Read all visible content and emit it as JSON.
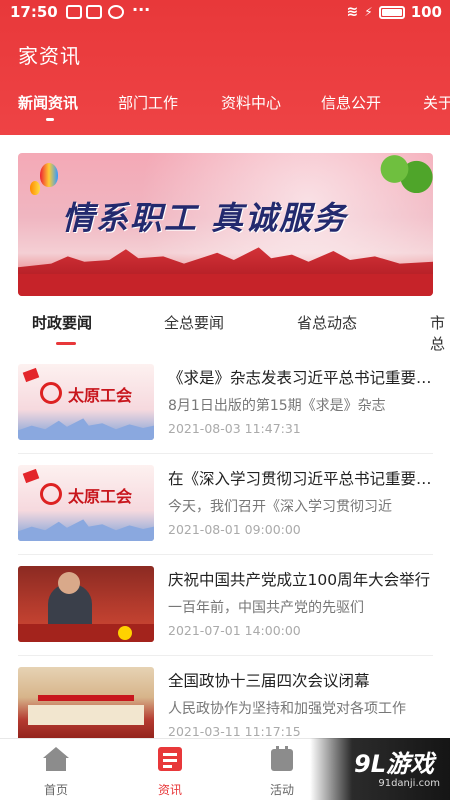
{
  "status_bar": {
    "time": "17:50",
    "battery": "100"
  },
  "header": {
    "title": "家资讯",
    "tabs": [
      {
        "label": "新闻资讯",
        "active": true
      },
      {
        "label": "部门工作"
      },
      {
        "label": "资料中心"
      },
      {
        "label": "信息公开"
      },
      {
        "label": "关于"
      }
    ]
  },
  "banner": {
    "slogan": "情系职工 真诚服务"
  },
  "sub_tabs": [
    {
      "label": "时政要闻",
      "active": true
    },
    {
      "label": "全总要闻"
    },
    {
      "label": "省总动态"
    },
    {
      "label": "市总"
    }
  ],
  "news": [
    {
      "title": "《求是》杂志发表习近平总书记重要文章",
      "summary": "8月1日出版的第15期《求是》杂志",
      "date": "2021-08-03 11:47:31",
      "thumb_text": "太原工会"
    },
    {
      "title": "在《深入学习贯彻习近平总书记重要讲话",
      "summary": "今天，我们召开《深入学习贯彻习近",
      "date": "2021-08-01 09:00:00",
      "thumb_text": "太原工会"
    },
    {
      "title": "庆祝中国共产党成立100周年大会举行",
      "summary": "一百年前，中国共产党的先驱们",
      "date": "2021-07-01 14:00:00",
      "thumb_text": ""
    },
    {
      "title": "全国政协十三届四次会议闭幕",
      "summary": "人民政协作为坚持和加强党对各项工作",
      "date": "2021-03-11 11:17:15",
      "thumb_text": ""
    }
  ],
  "bottom_nav": [
    {
      "label": "首页",
      "icon": "home-icon"
    },
    {
      "label": "资讯",
      "icon": "news-icon",
      "active": true
    },
    {
      "label": "活动",
      "icon": "activity-icon"
    }
  ],
  "watermark": {
    "text": "9L游戏",
    "url": "91danji.com"
  },
  "colors": {
    "accent": "#e8383a",
    "text": "#222222",
    "muted": "#777777"
  }
}
